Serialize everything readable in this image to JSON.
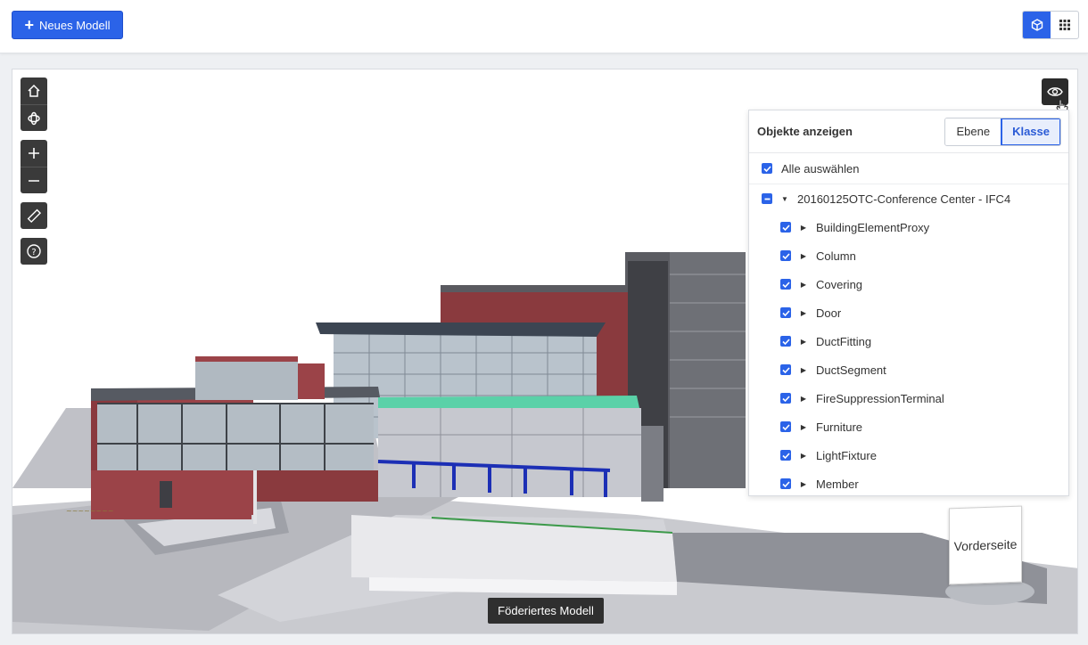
{
  "topbar": {
    "new_model_label": "Neues Modell",
    "view_modes": [
      {
        "icon": "cube-icon",
        "active": true
      },
      {
        "icon": "grid-icon",
        "active": false
      }
    ]
  },
  "viewer": {
    "toolbar": [
      "home-icon",
      "orbit-icon",
      "zoom-in-icon",
      "zoom-out-icon",
      "measure-icon",
      "help-icon"
    ],
    "federated_label": "Föderiertes Modell",
    "navcube_face": "Vorderseite"
  },
  "panel": {
    "title": "Objekte anzeigen",
    "tabs": [
      {
        "label": "Ebene",
        "active": false
      },
      {
        "label": "Klasse",
        "active": true
      }
    ],
    "select_all": "Alle auswählen",
    "root": "20160125OTC-Conference Center - IFC4",
    "items": [
      "BuildingElementProxy",
      "Column",
      "Covering",
      "Door",
      "DuctFitting",
      "DuctSegment",
      "FireSuppressionTerminal",
      "Furniture",
      "LightFixture",
      "Member"
    ]
  },
  "colors": {
    "accent": "#2b63e8",
    "dark_button": "#3a3a3a"
  }
}
